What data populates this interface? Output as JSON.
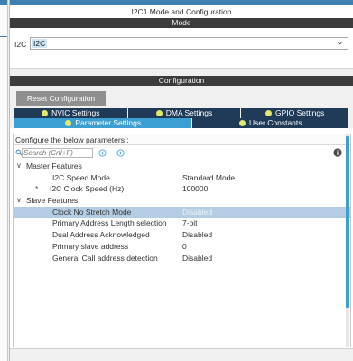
{
  "window": {
    "title": "I2C1 Mode and Configuration"
  },
  "mode": {
    "section_title": "Mode",
    "i2c_label": "I2C",
    "i2c_value": "I2C"
  },
  "configuration": {
    "section_title": "Configuration",
    "reset_button": "Reset Configuration",
    "tabs_row1": [
      {
        "label": "NVIC Settings"
      },
      {
        "label": "DMA Settings"
      },
      {
        "label": "GPIO Settings"
      }
    ],
    "tabs_row2": [
      {
        "label": "Parameter Settings",
        "active": true
      },
      {
        "label": "User Constants",
        "active": false
      }
    ],
    "params_header": "Configure the below parameters :",
    "search_placeholder": "Search (Crtl+F)",
    "groups": [
      {
        "title": "Master Features",
        "params": [
          {
            "name": "I2C Speed Mode",
            "value": "Standard Mode",
            "starred": false
          },
          {
            "name": "I2C Clock Speed (Hz)",
            "value": "100000",
            "starred": true
          }
        ]
      },
      {
        "title": "Slave Features",
        "params": [
          {
            "name": "Clock No Stretch Mode",
            "value": "Disabled",
            "selected": true
          },
          {
            "name": "Primary Address Length selection",
            "value": "7-bit"
          },
          {
            "name": "Dual Address Acknowledged",
            "value": "Disabled"
          },
          {
            "name": "Primary slave address",
            "value": "0"
          },
          {
            "name": "General Call address detection",
            "value": "Disabled"
          }
        ]
      }
    ]
  },
  "icons": {
    "search": "search-icon",
    "prev": "prev-match-icon",
    "next": "next-match-icon",
    "info": "info-icon",
    "chevron": "chevron-down-icon",
    "status_dot": "status-dot-icon"
  },
  "colors": {
    "accent": "#3d7fb0",
    "section_bar": "#3c3c3c",
    "tab_dark": "#1f3b57",
    "tab_active": "#3d9fd1",
    "dot": "#e3e86a",
    "selection": "#b4cde4"
  }
}
